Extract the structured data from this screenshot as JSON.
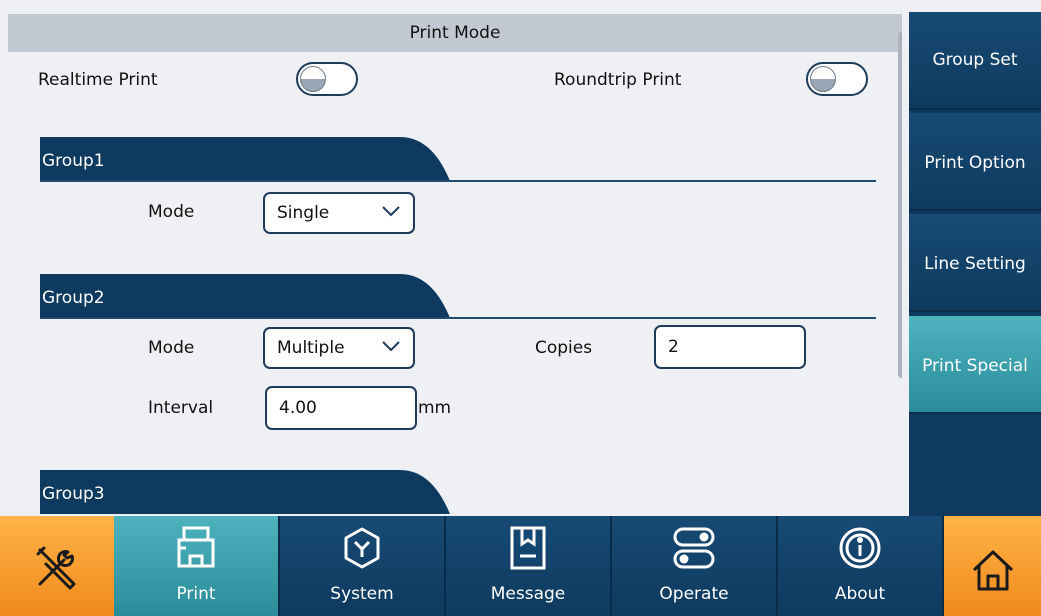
{
  "header": {
    "title": "Print Mode"
  },
  "toggles": [
    {
      "label": "Realtime Print"
    },
    {
      "label": "Roundtrip Print"
    }
  ],
  "groups": [
    {
      "name": "Group1",
      "mode_label": "Mode",
      "mode_value": "Single"
    },
    {
      "name": "Group2",
      "mode_label": "Mode",
      "mode_value": "Multiple",
      "copies_label": "Copies",
      "copies_value": "2",
      "interval_label": "Interval",
      "interval_value": "4.00",
      "interval_unit": "mm"
    },
    {
      "name": "Group3"
    }
  ],
  "sidebar": {
    "items": [
      {
        "label": "Group Set"
      },
      {
        "label": "Print Option"
      },
      {
        "label": "Line Setting"
      },
      {
        "label": "Print Special"
      }
    ],
    "active": "Print Special"
  },
  "bottom_nav": {
    "items": [
      {
        "label": "Print",
        "icon": "printer-icon"
      },
      {
        "label": "System",
        "icon": "system-icon"
      },
      {
        "label": "Message",
        "icon": "message-icon"
      },
      {
        "label": "Operate",
        "icon": "operate-icon"
      },
      {
        "label": "About",
        "icon": "info-icon"
      }
    ],
    "active": "Print",
    "left_icon": "tools-icon",
    "right_icon": "home-icon"
  },
  "colors": {
    "dark_blue": "#0f3a5f",
    "teal_active": "#3aa3b0",
    "orange": "#f5a030",
    "background": "#eef0f3"
  }
}
